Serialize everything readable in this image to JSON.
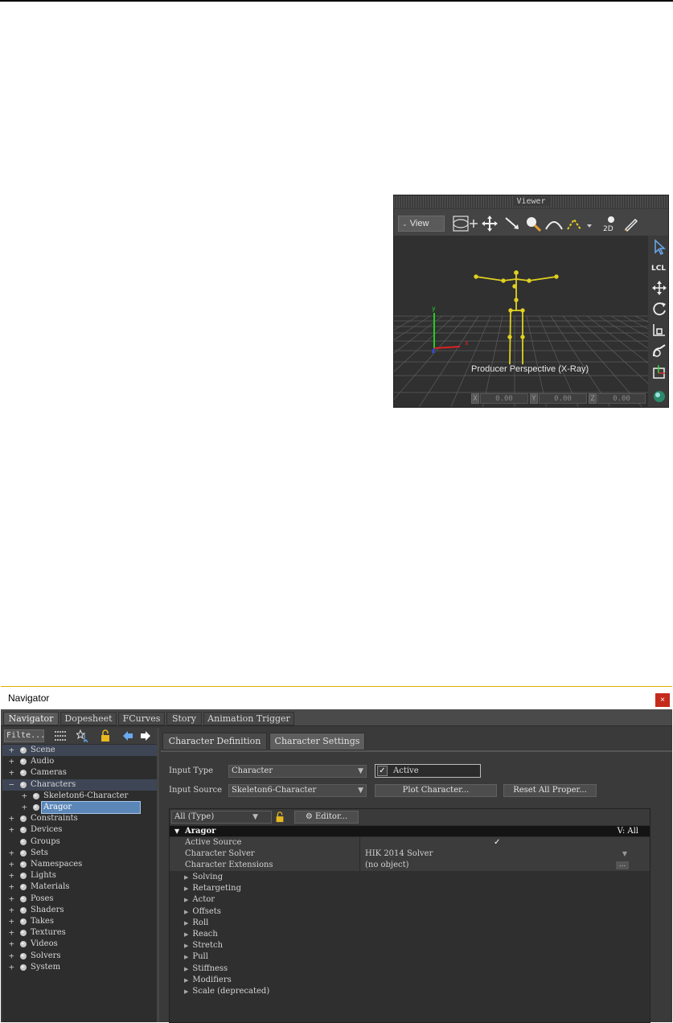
{
  "viewer": {
    "title": "Viewer",
    "view_label": "View",
    "perspective_label": "Producer Perspective (X-Ray)",
    "coords": [
      {
        "axis": "X",
        "value": "0.00"
      },
      {
        "axis": "Y",
        "value": "0.00"
      },
      {
        "axis": "Z",
        "value": "0.00"
      }
    ],
    "toolbar_2d": "2D",
    "side_lcl": "LCL"
  },
  "navigator": {
    "title": "Navigator",
    "close": "×",
    "tabs": [
      "Navigator",
      "Dopesheet",
      "FCurves",
      "Story",
      "Animation Trigger"
    ],
    "filter_label": "Filte...",
    "tree": [
      {
        "label": "Scene",
        "plus": "+",
        "depth": 0,
        "icon": "teapot-icon"
      },
      {
        "label": "Audio",
        "plus": "+",
        "depth": 0,
        "icon": "speaker-icon"
      },
      {
        "label": "Cameras",
        "plus": "+",
        "depth": 0,
        "icon": "camera-icon"
      },
      {
        "label": "Characters",
        "plus": "−",
        "depth": 0,
        "icon": "character-icon"
      },
      {
        "label": "Skeleton6-Character",
        "plus": "+",
        "depth": 1,
        "icon": "character-icon"
      },
      {
        "label": "Aragor",
        "plus": "+",
        "depth": 1,
        "icon": "character-icon"
      },
      {
        "label": "Constraints",
        "plus": "+",
        "depth": 0,
        "icon": "constraint-icon"
      },
      {
        "label": "Devices",
        "plus": "+",
        "depth": 0,
        "icon": "io-icon"
      },
      {
        "label": "Groups",
        "plus": "",
        "depth": 0,
        "icon": "group-icon"
      },
      {
        "label": "Sets",
        "plus": "+",
        "depth": 0,
        "icon": "folder-icon"
      },
      {
        "label": "Namespaces",
        "plus": "+",
        "depth": 0,
        "icon": "namespace-icon"
      },
      {
        "label": "Lights",
        "plus": "+",
        "depth": 0,
        "icon": "light-icon"
      },
      {
        "label": "Materials",
        "plus": "+",
        "depth": 0,
        "icon": "material-icon"
      },
      {
        "label": "Poses",
        "plus": "+",
        "depth": 0,
        "icon": "pose-icon"
      },
      {
        "label": "Shaders",
        "plus": "+",
        "depth": 0,
        "icon": "shader-icon"
      },
      {
        "label": "Takes",
        "plus": "+",
        "depth": 0,
        "icon": "take-icon"
      },
      {
        "label": "Textures",
        "plus": "+",
        "depth": 0,
        "icon": "texture-icon"
      },
      {
        "label": "Videos",
        "plus": "+",
        "depth": 0,
        "icon": "video-icon"
      },
      {
        "label": "Solvers",
        "plus": "+",
        "depth": 0,
        "icon": "solver-icon"
      },
      {
        "label": "System",
        "plus": "+",
        "depth": 0,
        "icon": "system-icon"
      }
    ],
    "subtabs": [
      "Character Definition",
      "Character Settings"
    ],
    "input_type_label": "Input Type",
    "input_type_value": "Character",
    "active_label": "Active",
    "active_check": "✓",
    "input_source_label": "Input Source",
    "input_source_value": "Skeleton6-Character",
    "plot_button": "Plot Character...",
    "reset_button": "Reset All Proper...",
    "filter_combo": "All (Type)",
    "editor_button": "Editor...",
    "section_title": "Aragor",
    "section_right": "V: All",
    "props": [
      {
        "label": "Active Source",
        "value": "✓"
      },
      {
        "label": "Character Solver",
        "value": "HIK 2014 Solver"
      },
      {
        "label": "Character Extensions",
        "value": "(no object)"
      }
    ],
    "groups": [
      "Solving",
      "Retargeting",
      "Actor",
      "Offsets",
      "Roll",
      "Reach",
      "Stretch",
      "Pull",
      "Stiffness",
      "Modifiers",
      "Scale (deprecated)"
    ],
    "ellipsis": "..."
  }
}
